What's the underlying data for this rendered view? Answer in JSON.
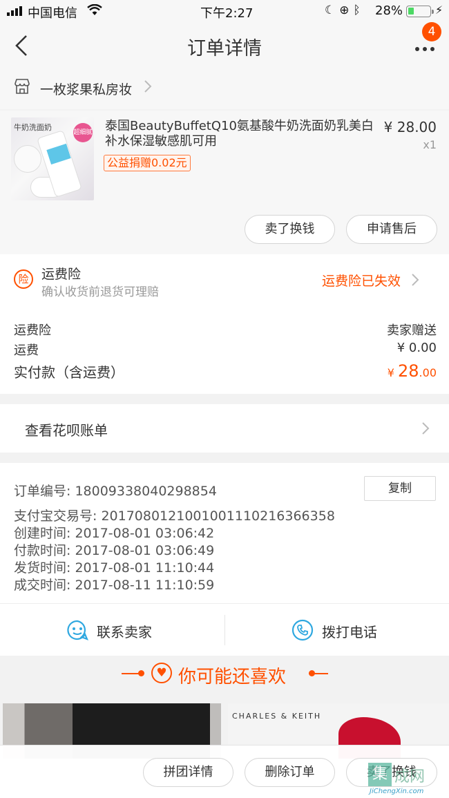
{
  "status_bar": {
    "carrier": "中国电信",
    "time": "下午2:27",
    "battery_pct": "28%",
    "battery_level": 0.28
  },
  "nav": {
    "title": "订单详情",
    "badge_count": "4"
  },
  "shop": {
    "name": "一枚浆果私房妆"
  },
  "product": {
    "title": "泰国BeautyBuffetQ10氨基酸牛奶洗面奶乳美白补水保湿敏感肌可用",
    "price": "¥ 28.00",
    "qty": "x1",
    "charity": "公益捐赠0.02元",
    "image_tag": "牛奶洗面奶",
    "image_badge": "超细腻",
    "btn_sell": "卖了换钱",
    "btn_aftersale": "申请售后"
  },
  "insurance": {
    "icon_text": "险",
    "title": "运费险",
    "subtitle": "确认收货前退货可理赔",
    "status": "运费险已失效"
  },
  "fees": {
    "rows": [
      {
        "label": "运费险",
        "value": "卖家赠送"
      },
      {
        "label": "运费",
        "value": "¥ 0.00"
      }
    ],
    "paid_label": "实付款（含运费）",
    "paid_currency": "¥ ",
    "paid_int": "28",
    "paid_dec": ".00"
  },
  "huabei": {
    "label": "查看花呗账单"
  },
  "order_info": {
    "copy_label": "复制",
    "lines": [
      "订单编号:  18009338040298854",
      "支付宝交易号:  2017080121001001110216366358",
      "创建时间:  2017-08-01 03:06:42",
      "付款时间:  2017-08-01 03:06:49",
      "发货时间:  2017-08-01 11:10:44",
      "成交时间:  2017-08-11 11:10:59"
    ]
  },
  "contact": {
    "seller": "联系卖家",
    "phone": "拨打电话"
  },
  "recommend": {
    "title": "你可能还喜欢",
    "brand": "CHARLES & KEITH"
  },
  "bottom": {
    "btn_group": "拼团详情",
    "btn_delete": "删除订单",
    "btn_sell": "卖了换钱"
  },
  "watermark": {
    "char": "集",
    "text": "成网",
    "url": "JiChengXin.com"
  },
  "colors": {
    "accent": "#ff5000",
    "battery_green": "#4cd964"
  }
}
